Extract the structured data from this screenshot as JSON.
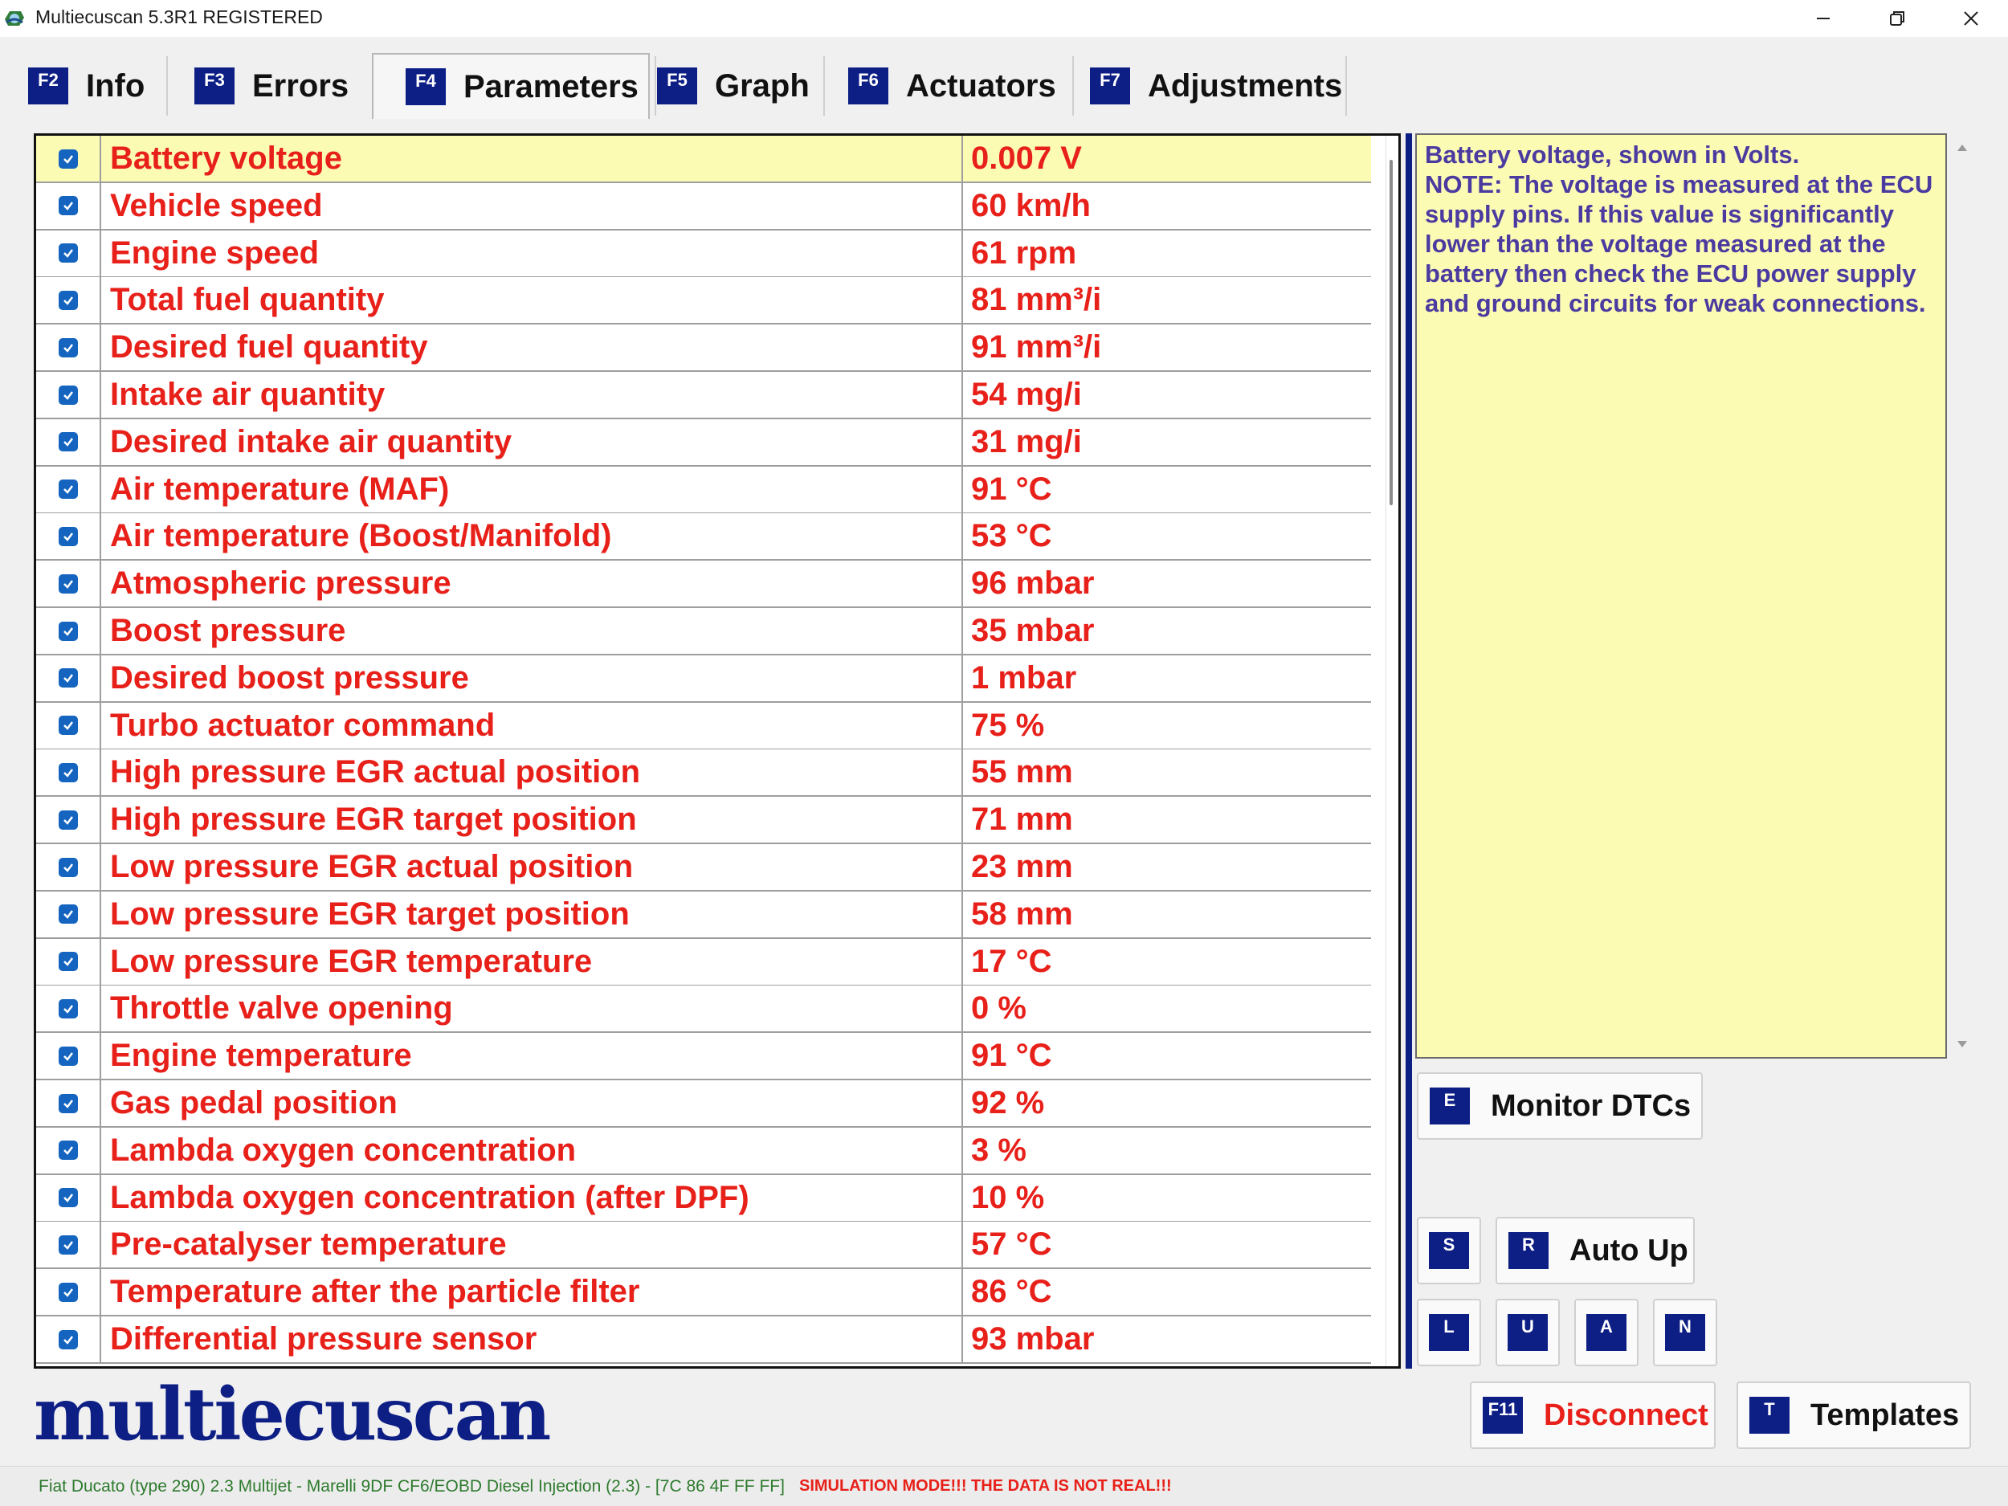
{
  "window": {
    "title": "Multiecuscan 5.3R1 REGISTERED"
  },
  "tabs": [
    {
      "key": "F2",
      "label": "Info"
    },
    {
      "key": "F3",
      "label": "Errors"
    },
    {
      "key": "F4",
      "label": "Parameters",
      "active": true
    },
    {
      "key": "F5",
      "label": "Graph"
    },
    {
      "key": "F6",
      "label": "Actuators"
    },
    {
      "key": "F7",
      "label": "Adjustments"
    }
  ],
  "parameters": [
    {
      "name": "Battery voltage",
      "value": "0.007 V",
      "checked": true,
      "selected": true
    },
    {
      "name": "Vehicle speed",
      "value": "60 km/h",
      "checked": true
    },
    {
      "name": "Engine speed",
      "value": "61 rpm",
      "checked": true
    },
    {
      "name": "Total fuel quantity",
      "value": "81 mm³/i",
      "checked": true
    },
    {
      "name": "Desired fuel quantity",
      "value": "91 mm³/i",
      "checked": true
    },
    {
      "name": "Intake air quantity",
      "value": "54 mg/i",
      "checked": true
    },
    {
      "name": "Desired intake air quantity",
      "value": "31 mg/i",
      "checked": true
    },
    {
      "name": "Air temperature (MAF)",
      "value": "91 °C",
      "checked": true
    },
    {
      "name": "Air temperature (Boost/Manifold)",
      "value": "53 °C",
      "checked": true
    },
    {
      "name": "Atmospheric pressure",
      "value": "96 mbar",
      "checked": true
    },
    {
      "name": "Boost pressure",
      "value": "35 mbar",
      "checked": true
    },
    {
      "name": "Desired boost pressure",
      "value": "1 mbar",
      "checked": true
    },
    {
      "name": "Turbo actuator command",
      "value": "75 %",
      "checked": true
    },
    {
      "name": "High pressure EGR actual position",
      "value": "55 mm",
      "checked": true
    },
    {
      "name": "High pressure EGR target position",
      "value": "71 mm",
      "checked": true
    },
    {
      "name": "Low pressure EGR actual position",
      "value": "23 mm",
      "checked": true
    },
    {
      "name": "Low pressure EGR target position",
      "value": "58 mm",
      "checked": true
    },
    {
      "name": "Low pressure EGR temperature",
      "value": "17 °C",
      "checked": true
    },
    {
      "name": "Throttle valve opening",
      "value": "0 %",
      "checked": true
    },
    {
      "name": "Engine temperature",
      "value": "91 °C",
      "checked": true
    },
    {
      "name": "Gas pedal position",
      "value": "92 %",
      "checked": true
    },
    {
      "name": "Lambda oxygen concentration",
      "value": "3 %",
      "checked": true
    },
    {
      "name": "Lambda oxygen concentration (after DPF)",
      "value": "10 %",
      "checked": true
    },
    {
      "name": "Pre-catalyser temperature",
      "value": "57 °C",
      "checked": true
    },
    {
      "name": "Temperature after the particle filter",
      "value": "86 °C",
      "checked": true
    },
    {
      "name": "Differential pressure sensor",
      "value": "93 mbar",
      "checked": true
    }
  ],
  "description": {
    "text": "Battery voltage, shown in Volts.\nNOTE: The voltage is measured at the ECU supply pins. If this value is significantly lower than the voltage measured at the battery then check the ECU power supply and ground circuits for weak connections."
  },
  "buttons": {
    "monitor_dtcs": {
      "key": "E",
      "label": "Monitor DTCs"
    },
    "s": {
      "key": "S"
    },
    "auto_up": {
      "key": "R",
      "label": "Auto Up"
    },
    "l": {
      "key": "L"
    },
    "u": {
      "key": "U"
    },
    "a": {
      "key": "A"
    },
    "n": {
      "key": "N"
    },
    "disconnect": {
      "key": "F11",
      "label": "Disconnect"
    },
    "templates": {
      "key": "T",
      "label": "Templates"
    }
  },
  "logo": {
    "text": "multiecuscan"
  },
  "status": {
    "vehicle": "Fiat Ducato (type 290) 2.3 Multijet - Marelli 9DF CF6/EOBD Diesel Injection (2.3) - [7C 86 4F FF FF]",
    "simulation": "SIMULATION MODE!!! THE DATA IS NOT REAL!!!"
  },
  "colors": {
    "accent": "#0d1e85",
    "value_text": "#e8201a",
    "selected_row": "#fbfbb4",
    "description_text": "#4b3aa0",
    "status_vehicle": "#2d7a2d"
  }
}
